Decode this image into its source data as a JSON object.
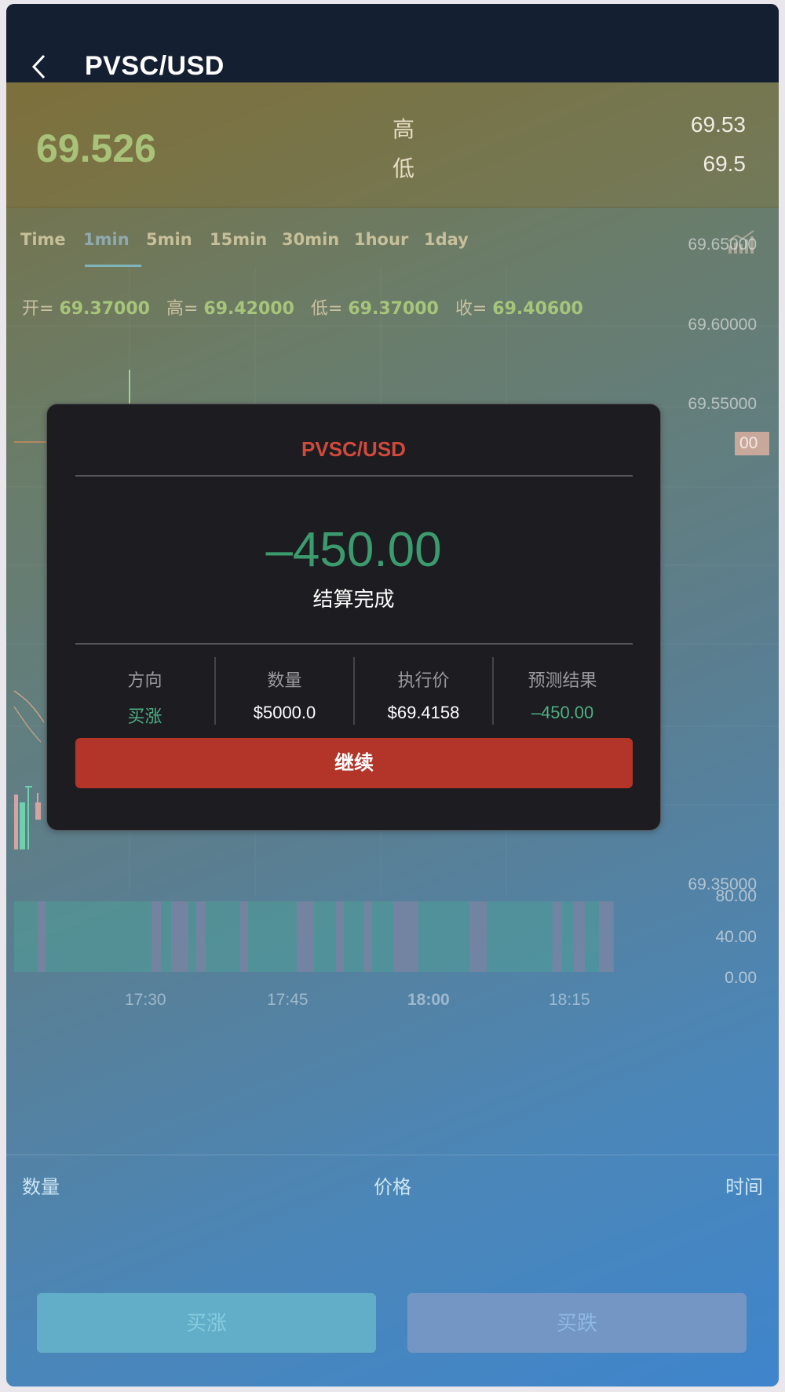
{
  "header": {
    "title": "PVSC/USD"
  },
  "quote": {
    "last_price": "69.526",
    "high_label": "高",
    "high_value": "69.53",
    "low_label": "低",
    "low_value": "69.5"
  },
  "tabs": [
    {
      "label": "Time"
    },
    {
      "label": "1min",
      "active": true
    },
    {
      "label": "5min"
    },
    {
      "label": "15min"
    },
    {
      "label": "30min"
    },
    {
      "label": "1hour"
    },
    {
      "label": "1day"
    }
  ],
  "chart": {
    "ohlc": {
      "open_label": "开=",
      "open": "69.37000",
      "high_label": "高=",
      "high": "69.42000",
      "low_label": "低=",
      "low": "69.37000",
      "close_label": "收=",
      "close": "69.40600"
    },
    "price_axis": [
      "69.65000",
      "69.60000",
      "69.55000",
      "69.35000"
    ],
    "price_tag_fragment": "00",
    "volume_axis": [
      "80.00",
      "40.00",
      "0.00"
    ],
    "time_axis": [
      "17:30",
      "17:45",
      "18:00",
      "18:15"
    ]
  },
  "list_header": {
    "qty": "数量",
    "price": "价格",
    "time": "时间"
  },
  "actions": {
    "buy_up": "买涨",
    "buy_down": "买跌"
  },
  "modal": {
    "title": "PVSC/USD",
    "amount": "–450.00",
    "status": "结算完成",
    "direction_label": "方向",
    "direction_value": "买涨",
    "quantity_label": "数量",
    "quantity_value": "$5000.0",
    "strike_label": "执行价",
    "strike_value": "$69.4158",
    "result_label": "预测结果",
    "result_value": "–450.00",
    "continue_label": "继续"
  },
  "colors": {
    "up": "#4fae82",
    "accent_red": "#b33429",
    "header_bg": "#141f32"
  }
}
